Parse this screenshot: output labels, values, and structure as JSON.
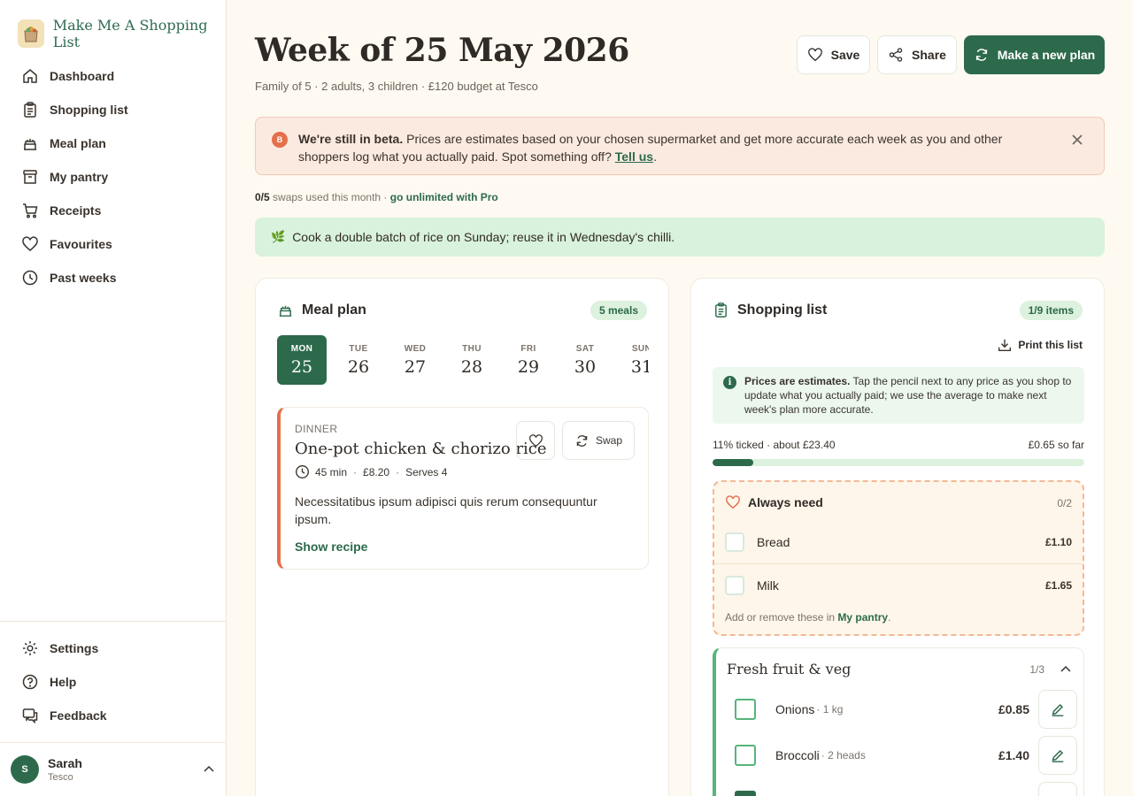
{
  "brand": {
    "name": "Make Me A Shopping List",
    "logo_icon": "shopping-bag-icon"
  },
  "sidebar": {
    "items": [
      {
        "label": "Dashboard",
        "icon": "home-icon"
      },
      {
        "label": "Shopping list",
        "icon": "clipboard-icon"
      },
      {
        "label": "Meal plan",
        "icon": "cake-icon"
      },
      {
        "label": "My pantry",
        "icon": "archive-icon"
      },
      {
        "label": "Receipts",
        "icon": "cart-icon"
      },
      {
        "label": "Favourites",
        "icon": "heart-icon"
      },
      {
        "label": "Past weeks",
        "icon": "clock-icon"
      }
    ],
    "bottom_items": [
      {
        "label": "Settings",
        "icon": "gear-icon"
      },
      {
        "label": "Help",
        "icon": "help-icon"
      },
      {
        "label": "Feedback",
        "icon": "chat-icon"
      }
    ],
    "user": {
      "initial": "S",
      "name": "Sarah",
      "store": "Tesco"
    }
  },
  "header": {
    "title": "Week of 25 May 2026",
    "subtitle": "Family of 5 · 2 adults, 3 children · £120 budget at Tesco",
    "save_label": "Save",
    "share_label": "Share",
    "new_plan_label": "Make a new plan"
  },
  "beta": {
    "badge": "B",
    "bold": "We're still in beta.",
    "text": " Prices are estimates based on your chosen supermarket and get more accurate each week as you and other shoppers log what you actually paid. Spot something off? ",
    "link": "Tell us",
    "end": "."
  },
  "swaps": {
    "count": "0/5",
    "text": " swaps used this month · ",
    "link": "go unlimited with Pro"
  },
  "tip": {
    "icon": "🌿",
    "text": "Cook a double batch of rice on Sunday; reuse it in Wednesday's chilli."
  },
  "meal_plan": {
    "title": "Meal plan",
    "badge": "5 meals",
    "days": [
      {
        "name": "MON",
        "num": "25"
      },
      {
        "name": "TUE",
        "num": "26"
      },
      {
        "name": "WED",
        "num": "27"
      },
      {
        "name": "THU",
        "num": "28"
      },
      {
        "name": "FRI",
        "num": "29"
      },
      {
        "name": "SAT",
        "num": "30"
      },
      {
        "name": "SUN",
        "num": "31"
      }
    ],
    "meal": {
      "type": "DINNER",
      "name": "One-pot chicken & chorizo rice",
      "time": "45 min",
      "cost": "£8.20",
      "serves": "Serves 4",
      "description": "Necessitatibus ipsum adipisci quis rerum consequuntur ipsum.",
      "show_recipe": "Show recipe",
      "swap_label": "Swap"
    }
  },
  "shopping": {
    "title": "Shopping list",
    "badge": "1/9 items",
    "print_label": "Print this list",
    "info_bold": "Prices are estimates.",
    "info_text": " Tap the pencil next to any price as you shop to update what you actually paid; we use the average to make next week's plan more accurate.",
    "progress_text": "11% ticked · about £23.40",
    "so_far": "£0.65 so far",
    "progress_fraction": 0.11,
    "always": {
      "title": "Always need",
      "count": "0/2",
      "items": [
        {
          "name": "Bread",
          "price": "£1.10"
        },
        {
          "name": "Milk",
          "price": "£1.65"
        }
      ],
      "foot_text": "Add or remove these in ",
      "foot_link": "My pantry",
      "foot_end": "."
    },
    "section": {
      "title": "Fresh fruit & veg",
      "count": "1/3",
      "items": [
        {
          "name": "Onions",
          "qty": " · 1 kg",
          "price": "£0.85"
        },
        {
          "name": "Broccoli",
          "qty": " · 2 heads",
          "price": "£1.40"
        }
      ]
    }
  },
  "colors": {
    "brand_green": "#2c6a4b",
    "accent_coral": "#e46f4c",
    "light_green": "#dcf1de",
    "beta_bg": "#fbeae0"
  }
}
